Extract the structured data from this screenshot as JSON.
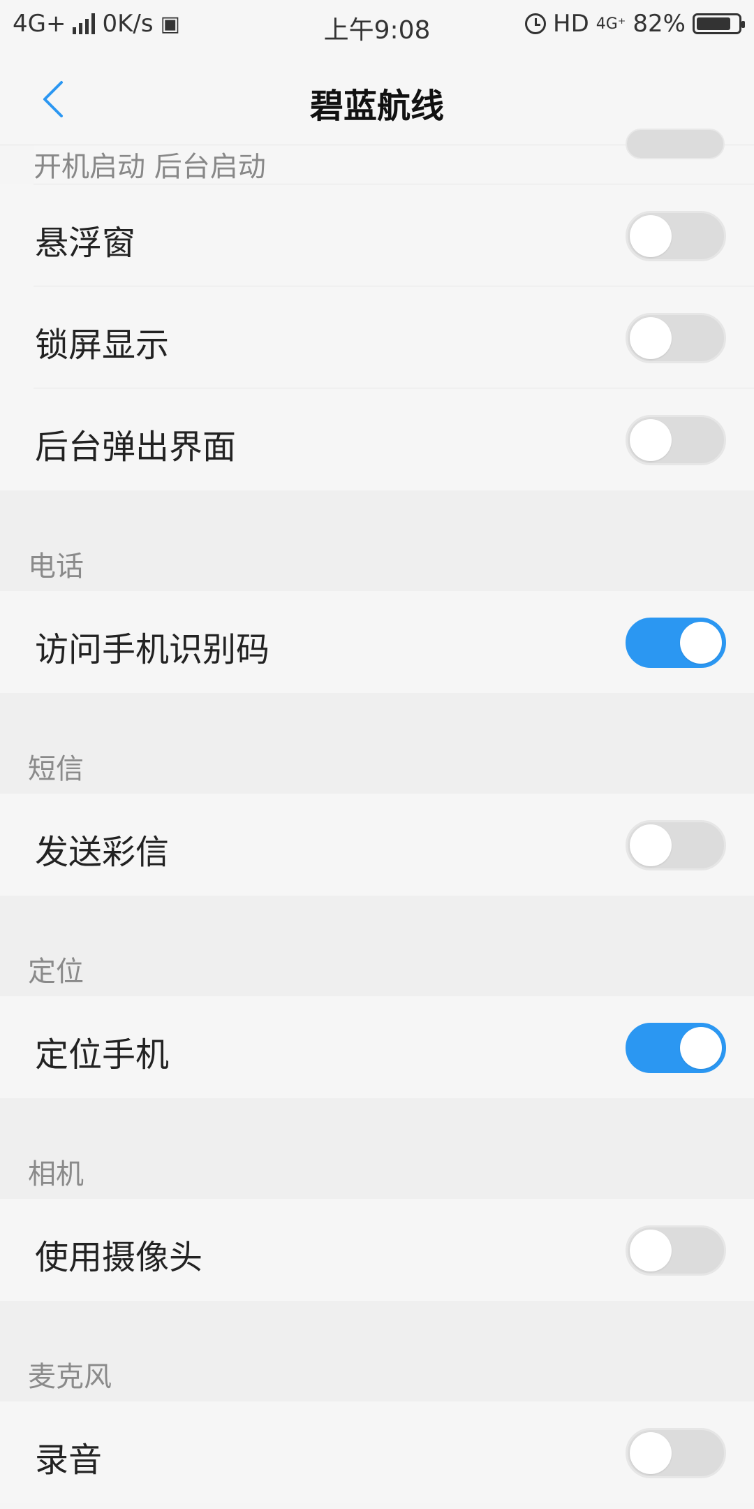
{
  "status_bar": {
    "network": "4G+",
    "speed": "0K/s",
    "time": "上午9:08",
    "hd": "HD",
    "net2": "4G⁺",
    "battery": "82%"
  },
  "header": {
    "title": "碧蓝航线"
  },
  "partial_row": {
    "label": "开机启动  后台启动"
  },
  "rows_top": [
    {
      "label": "悬浮窗",
      "on": false
    },
    {
      "label": "锁屏显示",
      "on": false
    },
    {
      "label": "后台弹出界面",
      "on": false
    }
  ],
  "sections": [
    {
      "title": "电话",
      "rows": [
        {
          "label": "访问手机识别码",
          "on": true
        }
      ]
    },
    {
      "title": "短信",
      "rows": [
        {
          "label": "发送彩信",
          "on": false
        }
      ]
    },
    {
      "title": "定位",
      "rows": [
        {
          "label": "定位手机",
          "on": true
        }
      ]
    },
    {
      "title": "相机",
      "rows": [
        {
          "label": "使用摄像头",
          "on": false
        }
      ]
    },
    {
      "title": "麦克风",
      "rows": [
        {
          "label": "录音",
          "on": false
        }
      ]
    }
  ],
  "colors": {
    "toggle_on": "#2b97f2",
    "toggle_off": "#dcdcdc",
    "accent_back": "#2b97f2"
  }
}
